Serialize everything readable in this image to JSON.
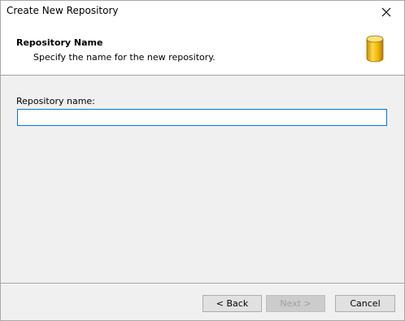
{
  "window": {
    "title": "Create New Repository",
    "close_symbol": "✕"
  },
  "header": {
    "title": "Repository Name",
    "subtitle": "Specify the name for the new repository.",
    "icon": "database-icon"
  },
  "form": {
    "repository_name_label": "Repository name:",
    "repository_name_value": ""
  },
  "footer": {
    "back_label": "< Back",
    "next_label": "Next >",
    "cancel_label": "Cancel"
  },
  "colors": {
    "input_focus_border": "#0078d7",
    "icon_gold": "#f0b400"
  }
}
